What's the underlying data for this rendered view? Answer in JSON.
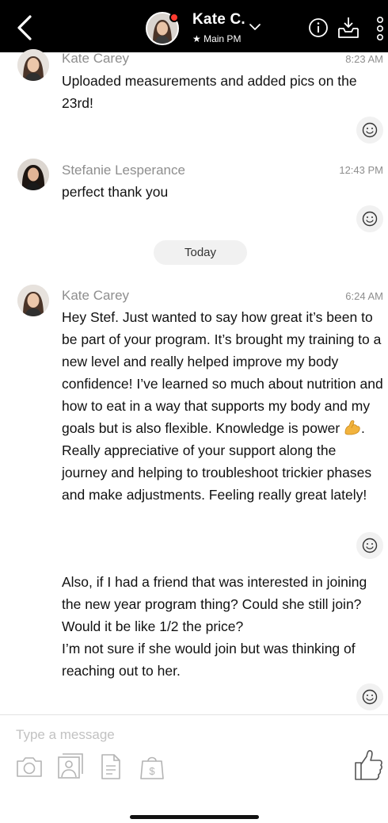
{
  "header": {
    "contact_name": "Kate C.",
    "contact_subtitle": "★ Main PM",
    "icons": [
      "back-icon",
      "chevron-down-icon",
      "info-icon",
      "inbox-download-icon",
      "more-vertical-icon"
    ],
    "status_dot_color": "#ff3b30"
  },
  "messages": [
    {
      "sender": "Kate Carey",
      "time": "8:23 AM",
      "text": "Uploaded measurements and added pics on the 23rd!"
    },
    {
      "sender": "Stefanie Lesperance",
      "time": "12:43 PM",
      "text": "perfect thank you"
    },
    {
      "sender": "Kate Carey",
      "time": "6:24 AM",
      "text_part1": "Hey Stef. Just wanted to say how great it’s been to be part of your program. It’s brought my training to a new level and really helped improve my body confidence! I’ve learned so much about nutrition and how to eat in a way that supports my body and my goals but is also flexible. Knowledge is power ",
      "emoji": "flexed-biceps-emoji",
      "text_part2": ". Really appreciative of your support along the journey and helping to troubleshoot trickier phases and make adjustments. Feeling really great lately!"
    },
    {
      "text": "Also, if I had a friend that was interested in joining the new year program thing? Could she still join? Would it be like 1/2 the price?\nI’m not sure if she would join but was thinking of reaching out to her."
    }
  ],
  "day_separator": "Today",
  "composer": {
    "placeholder": "Type a message",
    "tools": [
      "camera-icon",
      "photo-library-icon",
      "document-icon",
      "paid-content-icon",
      "thumbs-up-icon"
    ]
  }
}
